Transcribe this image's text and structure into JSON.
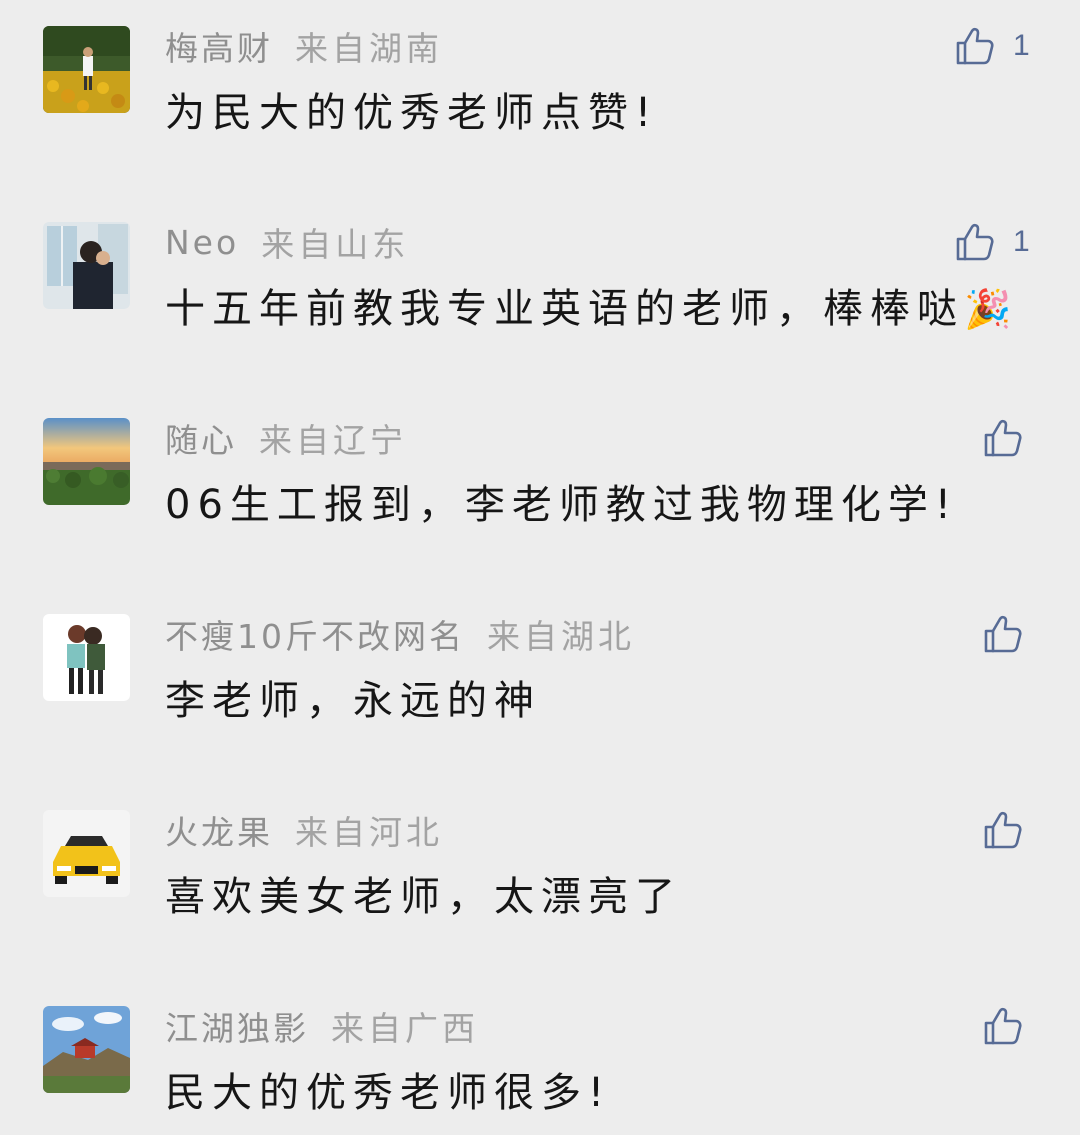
{
  "comments": [
    {
      "nickname": "梅高财",
      "location": "来自湖南",
      "text": "为民大的优秀老师点赞!",
      "emoji": "",
      "likes": "1"
    },
    {
      "nickname": "Neo",
      "location": "来自山东",
      "text": "十五年前教我专业英语的老师，棒棒哒",
      "emoji": "🎉",
      "likes": "1"
    },
    {
      "nickname": "随心",
      "location": "来自辽宁",
      "text": "06生工报到，李老师教过我物理化学!",
      "emoji": "",
      "likes": ""
    },
    {
      "nickname": "不瘦10斤不改网名",
      "location": "来自湖北",
      "text": "李老师，永远的神",
      "emoji": "",
      "likes": ""
    },
    {
      "nickname": "火龙果",
      "location": "来自河北",
      "text": "喜欢美女老师，太漂亮了",
      "emoji": "",
      "likes": ""
    },
    {
      "nickname": "江湖独影",
      "location": "来自广西",
      "text": "民大的优秀老师很多!",
      "emoji": "",
      "likes": ""
    }
  ],
  "icons": {
    "like": "thumbs-up-icon"
  },
  "colors": {
    "background": "#ededed",
    "like": "#576b95",
    "nickname": "#8f8f8f",
    "text": "#161616"
  }
}
